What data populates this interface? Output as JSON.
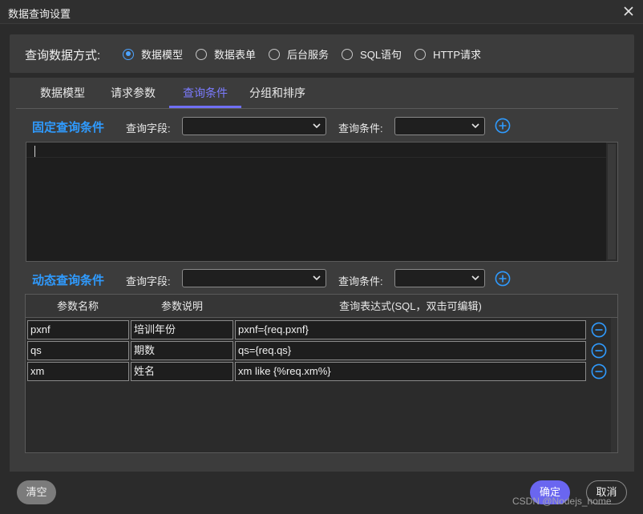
{
  "window": {
    "title": "数据查询设置",
    "close_icon": "close-icon"
  },
  "query_method": {
    "label": "查询数据方式:",
    "options": [
      {
        "label": "数据模型",
        "checked": true
      },
      {
        "label": "数据表单",
        "checked": false
      },
      {
        "label": "后台服务",
        "checked": false
      },
      {
        "label": "SQL语句",
        "checked": false
      },
      {
        "label": "HTTP请求",
        "checked": false
      }
    ]
  },
  "tabs": [
    {
      "label": "数据模型",
      "active": false
    },
    {
      "label": "请求参数",
      "active": false
    },
    {
      "label": "查询条件",
      "active": true
    },
    {
      "label": "分组和排序",
      "active": false
    }
  ],
  "fixed": {
    "title": "固定查询条件",
    "field_label": "查询字段:",
    "field_value": "",
    "condition_label": "查询条件:",
    "condition_value": "",
    "text": ""
  },
  "dynamic": {
    "title": "动态查询条件",
    "field_label": "查询字段:",
    "field_value": "",
    "condition_label": "查询条件:",
    "condition_value": ""
  },
  "table": {
    "columns": [
      "参数名称",
      "参数说明",
      "查询表达式(SQL，双击可编辑)"
    ],
    "rows": [
      {
        "name": "pxnf",
        "desc": "培训年份",
        "expr": "pxnf={req.pxnf}"
      },
      {
        "name": "qs",
        "desc": "期数",
        "expr": "qs={req.qs}"
      },
      {
        "name": "xm",
        "desc": "姓名",
        "expr": "xm like {%req.xm%}"
      }
    ]
  },
  "buttons": {
    "clear": "清空",
    "ok": "确定",
    "cancel": "取消"
  },
  "watermark": "CSDN @Nodejs_home",
  "colors": {
    "accent": "#2f9bff",
    "tab_active": "#7b7bff",
    "primary_button": "#6a66f0"
  }
}
